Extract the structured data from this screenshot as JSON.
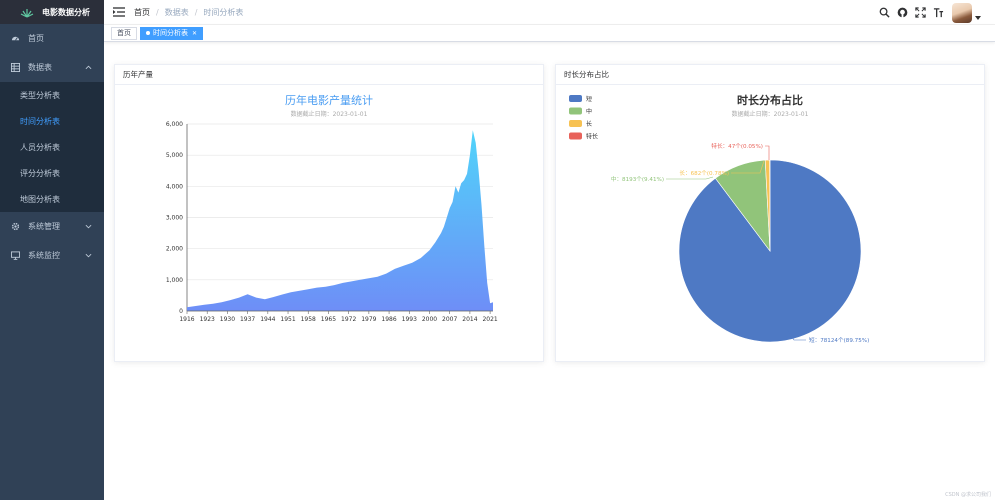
{
  "sidebar": {
    "brand": "电影数据分析",
    "items": [
      {
        "label": "首页",
        "icon": "dashboard-icon"
      },
      {
        "label": "数据表",
        "icon": "table-icon",
        "expanded": true,
        "children": [
          "类型分析表",
          "时间分析表",
          "人员分析表",
          "评分分析表",
          "地图分析表"
        ],
        "active_child": "时间分析表"
      },
      {
        "label": "系统管理",
        "icon": "gear-icon"
      },
      {
        "label": "系统监控",
        "icon": "monitor-icon"
      }
    ],
    "colors": {
      "bg": "#304156",
      "active": "#409eff"
    }
  },
  "header": {
    "breadcrumb": [
      "首页",
      "数据表",
      "时间分析表"
    ],
    "tools": [
      "search-icon",
      "github-icon",
      "fullscreen-icon",
      "font-size-icon"
    ]
  },
  "tags": {
    "items": [
      {
        "label": "首页",
        "active": false
      },
      {
        "label": "时间分析表",
        "active": true
      }
    ]
  },
  "cards": {
    "left_title": "历年产量",
    "right_title": "时长分布占比"
  },
  "footer": "CSDN @求公司我们",
  "chart_data": [
    {
      "type": "area",
      "title": "历年电影产量统计",
      "subtitle": "数据截止日期：2023-01-01",
      "x_ticks": [
        "1916",
        "1923",
        "1930",
        "1937",
        "1944",
        "1951",
        "1958",
        "1965",
        "1972",
        "1979",
        "1986",
        "1993",
        "2000",
        "2007",
        "2014",
        "2021"
      ],
      "ylim": [
        0,
        6000
      ],
      "y_ticks": [
        "0",
        "1,000",
        "2,000",
        "3,000",
        "4,000",
        "5,000",
        "6,000"
      ],
      "x": [
        1916,
        1919,
        1922,
        1925,
        1928,
        1931,
        1934,
        1937,
        1940,
        1943,
        1946,
        1949,
        1952,
        1955,
        1958,
        1961,
        1964,
        1967,
        1970,
        1973,
        1976,
        1979,
        1982,
        1985,
        1988,
        1991,
        1994,
        1997,
        2000,
        2002,
        2004,
        2005,
        2006,
        2007,
        2008,
        2009,
        2010,
        2011,
        2012,
        2013,
        2014,
        2015,
        2016,
        2017,
        2018,
        2019,
        2020,
        2021,
        2022
      ],
      "values": [
        120,
        160,
        200,
        230,
        280,
        350,
        430,
        540,
        430,
        380,
        450,
        530,
        600,
        650,
        700,
        750,
        780,
        830,
        900,
        950,
        1000,
        1050,
        1100,
        1200,
        1350,
        1450,
        1550,
        1700,
        1950,
        2200,
        2500,
        2700,
        3000,
        3300,
        3500,
        4000,
        3800,
        4100,
        4200,
        4400,
        5000,
        5800,
        5400,
        4500,
        3400,
        2100,
        900,
        250,
        280
      ],
      "colors": {
        "top": "#50d4fa",
        "bottom": "#6e8ef7"
      },
      "grid": true
    },
    {
      "type": "pie",
      "title": "时长分布占比",
      "subtitle": "数据截止日期：2023-01-01",
      "legend_position": "top-left",
      "slices": [
        {
          "name": "短",
          "value": 78124,
          "label": "短：78124个(89.75%)",
          "color": "#4e79c4"
        },
        {
          "name": "中",
          "value": 8193,
          "label": "中：8193个(9.41%)",
          "color": "#91c47a"
        },
        {
          "name": "长",
          "value": 682,
          "label": "长：682个(0.78%)",
          "color": "#f7c253"
        },
        {
          "name": "特长",
          "value": 47,
          "label": "特长：47个(0.05%)",
          "color": "#e8625a"
        }
      ]
    }
  ]
}
